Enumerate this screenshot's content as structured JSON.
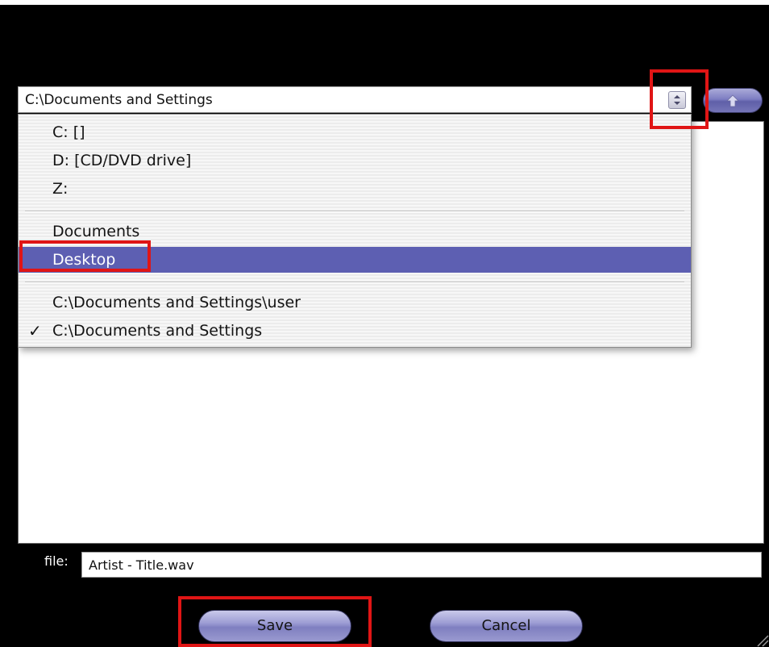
{
  "path_combo": {
    "current_path": "C:\\Documents and Settings"
  },
  "dropdown": {
    "items": [
      {
        "label": "C: []",
        "checked": false,
        "selected": false
      },
      {
        "label": "D: [CD/DVD drive]",
        "checked": false,
        "selected": false
      },
      {
        "label": "Z:",
        "checked": false,
        "selected": false
      },
      {
        "label": "Documents",
        "checked": false,
        "selected": false
      },
      {
        "label": "Desktop",
        "checked": false,
        "selected": true
      },
      {
        "label": "C:\\Documents and Settings\\user",
        "checked": false,
        "selected": false
      },
      {
        "label": "C:\\Documents and Settings",
        "checked": true,
        "selected": false
      }
    ],
    "check_mark": "✓"
  },
  "file_field": {
    "label": "file:",
    "value": "Artist - Title.wav"
  },
  "buttons": {
    "save_label": "Save",
    "cancel_label": "Cancel"
  },
  "icons": {
    "combo_arrows": "updown-arrows-icon",
    "up_folder": "up-arrow-icon"
  },
  "colors": {
    "selection": "#5d5fb2",
    "highlight": "#e01515",
    "button": "#9d9dd4"
  }
}
